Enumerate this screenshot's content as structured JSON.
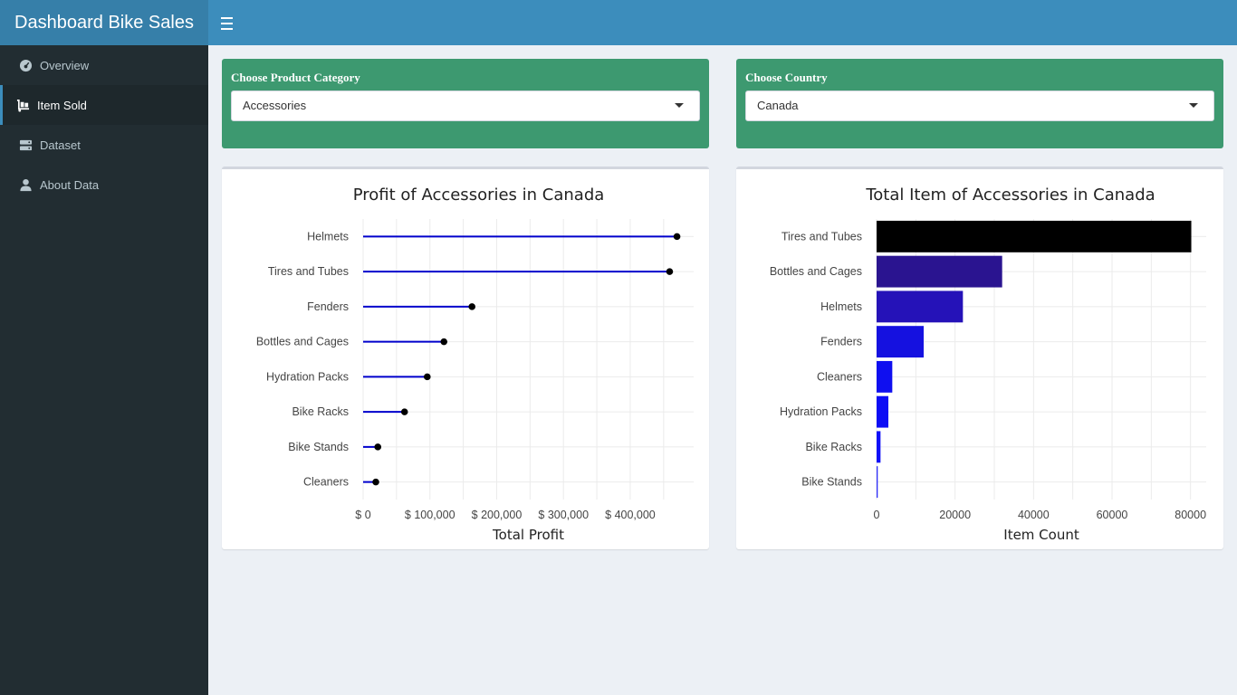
{
  "header": {
    "title": "Dashboard Bike Sales"
  },
  "sidebar": {
    "items": [
      {
        "label": "Overview",
        "icon": "dashboard-icon",
        "active": false
      },
      {
        "label": "Item Sold",
        "icon": "dolly-icon",
        "active": true
      },
      {
        "label": "Dataset",
        "icon": "server-icon",
        "active": false
      },
      {
        "label": "About Data",
        "icon": "user-icon",
        "active": false
      }
    ]
  },
  "filters": {
    "category": {
      "label": "Choose Product Category",
      "value": "Accessories"
    },
    "country": {
      "label": "Choose Country",
      "value": "Canada"
    }
  },
  "colors": {
    "header": "#3c8dbc",
    "logo": "#367fa9",
    "sidebar": "#222d32",
    "filter_box": "#3d9970",
    "lollipop_line": "#0000cc",
    "lollipop_dot": "#000000"
  },
  "chart_data": [
    {
      "type": "lollipop",
      "title": "Profit of Accessories in Canada",
      "xlabel": "Total Profit",
      "ylabel": "",
      "categories": [
        "Helmets",
        "Tires and Tubes",
        "Fenders",
        "Bottles and Cages",
        "Hydration Packs",
        "Bike Racks",
        "Bike Stands",
        "Cleaners"
      ],
      "values": [
        470000,
        459000,
        163000,
        121000,
        96000,
        62000,
        22000,
        19000
      ],
      "xlim": [
        0,
        495000
      ],
      "xticks": [
        0,
        100000,
        200000,
        300000,
        400000
      ],
      "xtick_labels": [
        "$ 0",
        "$ 100,000",
        "$ 200,000",
        "$ 300,000",
        "$ 400,000"
      ],
      "grid": true
    },
    {
      "type": "bar",
      "orientation": "horizontal",
      "title": "Total Item of Accessories in Canada",
      "xlabel": "Item Count",
      "ylabel": "",
      "categories": [
        "Tires and Tubes",
        "Bottles and Cages",
        "Helmets",
        "Fenders",
        "Cleaners",
        "Hydration Packs",
        "Bike Racks",
        "Bike Stands"
      ],
      "values": [
        80200,
        32000,
        22000,
        12000,
        4000,
        3000,
        1000,
        300
      ],
      "colors": [
        "#000000",
        "#2a1490",
        "#2512b8",
        "#1511e0",
        "#0f0ff0",
        "#0d0df5",
        "#1010f8",
        "#2b2bfa"
      ],
      "xlim": [
        0,
        84000
      ],
      "xticks": [
        0,
        20000,
        40000,
        60000,
        80000
      ],
      "xtick_labels": [
        "0",
        "20000",
        "40000",
        "60000",
        "80000"
      ],
      "grid": true
    }
  ]
}
